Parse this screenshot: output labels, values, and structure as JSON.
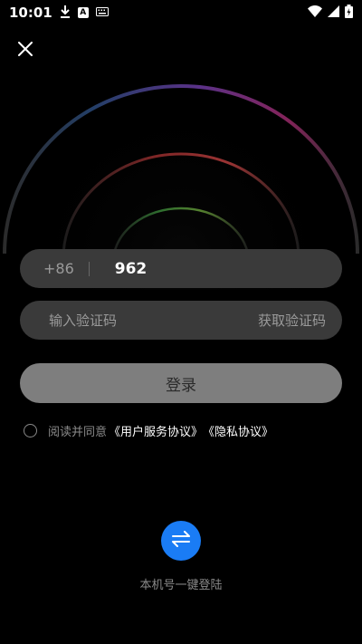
{
  "status_bar": {
    "time": "10:01",
    "icons": [
      "download-icon",
      "a-icon",
      "keyboard-icon",
      "wifi-icon",
      "signal-icon",
      "battery-icon"
    ]
  },
  "phone": {
    "country_code": "+86",
    "value": "962"
  },
  "verification": {
    "placeholder": "输入验证码",
    "get_code_label": "获取验证码"
  },
  "login": {
    "label": "登录"
  },
  "agreement": {
    "prefix": "阅读并同意",
    "user_agreement": "《用户服务协议》",
    "privacy_policy": "《隐私协议》"
  },
  "one_click": {
    "label": "本机号一键登陆"
  },
  "colors": {
    "background": "#000000",
    "input_bg": "#3a3a3a",
    "login_button_bg": "#7e7e7e",
    "accent": "#1a7cf5"
  }
}
